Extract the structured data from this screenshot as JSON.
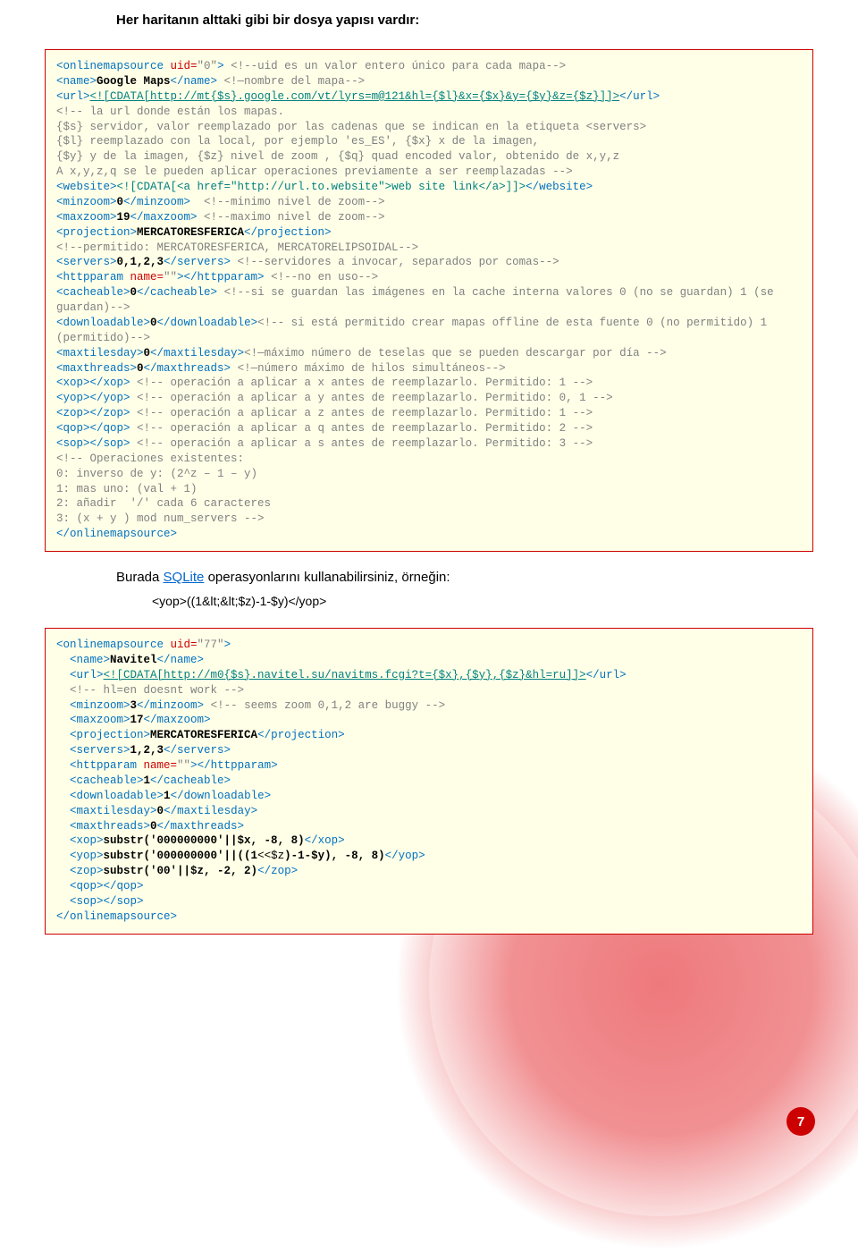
{
  "heading": "Her haritanın alttaki gibi bir dosya yapısı vardır:",
  "code1": {
    "l01a": "<onlinemapsource",
    "l01b": " uid=",
    "l01c": "\"0\"",
    "l01d": "> ",
    "l01e": "<!--uid es un valor entero único para cada mapa-->",
    "l02a": "<name>",
    "l02b": "Google Maps",
    "l02c": "</name> ",
    "l02d": "<!—nombre del mapa-->",
    "l03a": "<url>",
    "l03b": "<![CDATA[http://mt{$s}.google.com/vt/lyrs=m@121&hl={$l}&x={$x}&y={$y}&z={$z}]]>",
    "l03c": "</url>",
    "l04": "<!-- la url donde están los mapas.\n{$s} servidor, valor reemplazado por las cadenas que se indican en la etiqueta <servers>\n{$l} reemplazado con la local, por ejemplo 'es_ES', {$x} x de la imagen,\n{$y} y de la imagen, {$z} nivel de zoom , {$q} quad encoded valor, obtenido de x,y,z\nA x,y,z,q se le pueden aplicar operaciones previamente a ser reemplazadas -->",
    "l05a": "<website>",
    "l05b": "<![CDATA[<a href=\"http://url.to.website\">web site link</a>]]>",
    "l05c": "</website>",
    "l06a": "<minzoom>",
    "l06b": "0",
    "l06c": "</minzoom>  ",
    "l06d": "<!--minimo nivel de zoom-->",
    "l07a": "<maxzoom>",
    "l07b": "19",
    "l07c": "</maxzoom> ",
    "l07d": "<!--maximo nivel de zoom-->",
    "l08a": "<projection>",
    "l08b": "MERCATORESFERICA",
    "l08c": "</projection>",
    "l09": "<!--permitido: MERCATORESFERICA, MERCATORELIPSOIDAL-->",
    "l10a": "<servers>",
    "l10b": "0,1,2,3",
    "l10c": "</servers> ",
    "l10d": "<!--servidores a invocar, separados por comas-->",
    "l11a": "<httpparam",
    "l11b": " name=",
    "l11c": "\"\"",
    "l11d": "></httpparam> ",
    "l11e": "<!--no en uso-->",
    "l12a": "<cacheable>",
    "l12b": "0",
    "l12c": "</cacheable> ",
    "l12d": "<!--si se guardan las imágenes en la cache interna valores 0 (no se guardan) 1 (se guardan)-->",
    "l13a": "<downloadable>",
    "l13b": "0",
    "l13c": "</downloadable>",
    "l13d": "<!-- si está permitido crear mapas offline de esta fuente 0 (no permitido) 1 (permitido)-->",
    "l14a": "<maxtilesday>",
    "l14b": "0",
    "l14c": "</maxtilesday>",
    "l14d": "<!—máximo número de teselas que se pueden descargar por día -->",
    "l15a": "<maxthreads>",
    "l15b": "0",
    "l15c": "</maxthreads> ",
    "l15d": "<!—número máximo de hilos simultáneos-->",
    "l16a": "<xop></xop> ",
    "l16b": "<!-- operación a aplicar a x antes de reemplazarlo. Permitido: 1 -->",
    "l17a": "<yop></yop> ",
    "l17b": "<!-- operación a aplicar a y antes de reemplazarlo. Permitido: 0, 1 -->",
    "l18a": "<zop></zop> ",
    "l18b": "<!-- operación a aplicar a z antes de reemplazarlo. Permitido: 1 -->",
    "l19a": "<qop></qop> ",
    "l19b": "<!-- operación a aplicar a q antes de reemplazarlo. Permitido: 2 -->",
    "l20a": "<sop></sop> ",
    "l20b": "<!-- operación a aplicar a s antes de reemplazarlo. Permitido: 3 -->",
    "l21": "<!-- Operaciones existentes:\n0: inverso de y: (2^z – 1 – y)\n1: mas uno: (val + 1)\n2: añadir  '/' cada 6 caracteres\n3: (x + y ) mod num_servers -->",
    "l22": "</onlinemapsource>"
  },
  "midtext_a": "Burada ",
  "midtext_link": "SQLite",
  "midtext_b": " operasyonlarını kullanabilirsiniz, örneğin:",
  "yop_line": "<yop>((1&lt;&lt;$z)-1-$y)</yop>",
  "code2": {
    "l01a": "<onlinemapsource",
    "l01b": " uid=",
    "l01c": "\"77\"",
    "l01d": ">",
    "l02a": "<name>",
    "l02b": "Navitel",
    "l02c": "</name>",
    "l03a": "<url>",
    "l03b": "<![CDATA[http://m0{$s}.navitel.su/navitms.fcgi?t={$x},{$y},{$z}&hl=ru]]>",
    "l03c": "</url>",
    "l04": "<!-- hl=en doesnt work -->",
    "l05a": "<minzoom>",
    "l05b": "3",
    "l05c": "</minzoom> ",
    "l05d": "<!-- seems zoom 0,1,2 are buggy -->",
    "l06a": "<maxzoom>",
    "l06b": "17",
    "l06c": "</maxzoom>",
    "l07a": "<projection>",
    "l07b": "MERCATORESFERICA",
    "l07c": "</projection>",
    "l08a": "<servers>",
    "l08b": "1,2,3",
    "l08c": "</servers>",
    "l09a": "<httpparam",
    "l09b": " name=",
    "l09c": "\"\"",
    "l09d": "></httpparam>",
    "l10a": "<cacheable>",
    "l10b": "1",
    "l10c": "</cacheable>",
    "l11a": "<downloadable>",
    "l11b": "1",
    "l11c": "</downloadable>",
    "l12a": "<maxtilesday>",
    "l12b": "0",
    "l12c": "</maxtilesday>",
    "l13a": "<maxthreads>",
    "l13b": "0",
    "l13c": "</maxthreads>",
    "l14a": "<xop>",
    "l14b": "substr('000000000'||$x, -8, 8)",
    "l14c": "</xop>",
    "l15a": "<yop>",
    "l15b": "substr('000000000'||((1",
    "l15c": "<<$z",
    "l15d": ")-1-$y), -8, 8)",
    "l15e": "</yop>",
    "l16a": "<zop>",
    "l16b": "substr('00'||$z, -2, 2)",
    "l16c": "</zop>",
    "l17": "<qop></qop>",
    "l18": "<sop></sop>",
    "l19": "</onlinemapsource>"
  },
  "page_number": "7"
}
